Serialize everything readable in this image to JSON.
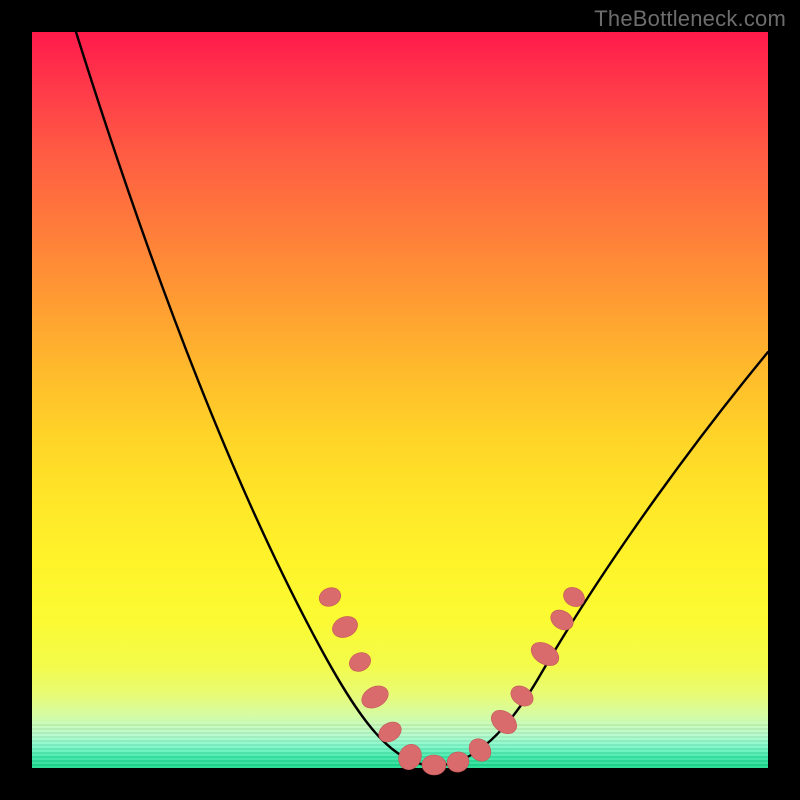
{
  "watermark": "TheBottleneck.com",
  "colors": {
    "frame": "#000000",
    "curve": "#000000",
    "marker_fill": "#d96b6d",
    "marker_stroke": "#c75c5e"
  },
  "chart_data": {
    "type": "line",
    "title": "",
    "xlabel": "",
    "ylabel": "",
    "xlim": [
      0,
      100
    ],
    "ylim": [
      0,
      100
    ],
    "series": [
      {
        "name": "bottleneck-curve",
        "x": [
          6,
          10,
          14,
          18,
          22,
          26,
          30,
          34,
          38,
          42,
          46,
          48,
          50,
          52,
          54,
          56,
          60,
          64,
          68,
          72,
          76,
          80,
          84,
          88,
          92,
          96,
          100
        ],
        "y": [
          100,
          90,
          80,
          70,
          61,
          52,
          44,
          36,
          28,
          20,
          11,
          7,
          3,
          1,
          0,
          0,
          1,
          4,
          9,
          15,
          22,
          29,
          36,
          42,
          48,
          53,
          57
        ]
      }
    ],
    "markers": {
      "name": "highlight-points",
      "x": [
        40,
        42,
        44,
        47,
        49,
        52,
        55,
        57,
        59,
        62,
        64,
        67,
        69,
        70
      ],
      "y": [
        24,
        20,
        15,
        10,
        5,
        1,
        0,
        0,
        1,
        5,
        8,
        15,
        20,
        23
      ]
    },
    "gradient_stops": [
      {
        "pos": 0.0,
        "color": "#ff1a4b"
      },
      {
        "pos": 0.25,
        "color": "#ff7a3b"
      },
      {
        "pos": 0.5,
        "color": "#ffd428"
      },
      {
        "pos": 0.78,
        "color": "#fbfb33"
      },
      {
        "pos": 0.95,
        "color": "#b3fbc9"
      },
      {
        "pos": 1.0,
        "color": "#17d98b"
      }
    ]
  }
}
